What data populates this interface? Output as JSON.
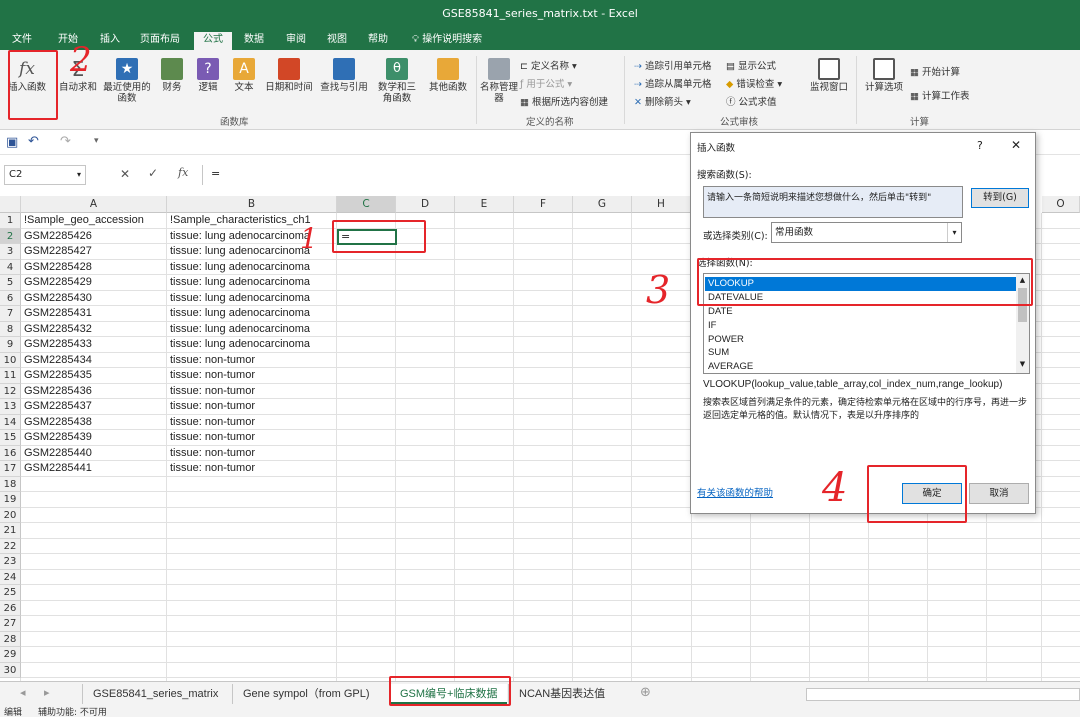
{
  "window": {
    "title": "GSE85841_series_matrix.txt  -  Excel"
  },
  "ribbon_tabs": [
    "文件",
    "开始",
    "插入",
    "页面布局",
    "公式",
    "数据",
    "审阅",
    "视图",
    "帮助"
  ],
  "active_tab": "公式",
  "tell_me": "操作说明搜索",
  "ribbon": {
    "insert_function": "插入函数",
    "autosum": "自动求和",
    "recent": "最近使用的函数",
    "financial": "财务",
    "logical": "逻辑",
    "text": "文本",
    "datetime": "日期和时间",
    "lookup": "查找与引用",
    "math": "数学和三角函数",
    "more": "其他函数",
    "group_library": "函数库",
    "name_manager": "名称管理器",
    "define_name": "定义名称",
    "use_in_formula": "用于公式",
    "create_from_selection": "根据所选内容创建",
    "group_defined_names": "定义的名称",
    "trace_precedents": "追踪引用单元格",
    "trace_dependents": "追踪从属单元格",
    "remove_arrows": "删除箭头",
    "show_formulas": "显示公式",
    "error_checking": "错误检查",
    "evaluate_formula": "公式求值",
    "group_auditing": "公式审核",
    "watch_window": "监视窗口",
    "calc_options": "计算选项",
    "calc_now": "开始计算",
    "calc_sheet": "计算工作表",
    "group_calc": "计算"
  },
  "formula_bar": {
    "name_box": "C2",
    "formula": "="
  },
  "columns": [
    "A",
    "B",
    "C",
    "D",
    "E",
    "F",
    "G",
    "H",
    "O"
  ],
  "rows": [
    [
      "!Sample_geo_accession",
      "!Sample_characteristics_ch1"
    ],
    [
      "GSM2285426",
      "tissue: lung adenocarcinoma"
    ],
    [
      "GSM2285427",
      "tissue: lung adenocarcinoma"
    ],
    [
      "GSM2285428",
      "tissue: lung adenocarcinoma"
    ],
    [
      "GSM2285429",
      "tissue: lung adenocarcinoma"
    ],
    [
      "GSM2285430",
      "tissue: lung adenocarcinoma"
    ],
    [
      "GSM2285431",
      "tissue: lung adenocarcinoma"
    ],
    [
      "GSM2285432",
      "tissue: lung adenocarcinoma"
    ],
    [
      "GSM2285433",
      "tissue: lung adenocarcinoma"
    ],
    [
      "GSM2285434",
      "tissue: non-tumor"
    ],
    [
      "GSM2285435",
      "tissue: non-tumor"
    ],
    [
      "GSM2285436",
      "tissue: non-tumor"
    ],
    [
      "GSM2285437",
      "tissue: non-tumor"
    ],
    [
      "GSM2285438",
      "tissue: non-tumor"
    ],
    [
      "GSM2285439",
      "tissue: non-tumor"
    ],
    [
      "GSM2285440",
      "tissue: non-tumor"
    ],
    [
      "GSM2285441",
      "tissue: non-tumor"
    ]
  ],
  "row_count": 30,
  "active_cell_value": "=",
  "sheets": [
    "GSE85841_series_matrix",
    "Gene sympol（from GPL)",
    "GSM编号+临床数据",
    "NCAN基因表达值"
  ],
  "active_sheet": "GSM编号+临床数据",
  "status": {
    "mode": "编辑",
    "accessibility": "辅助功能: 不可用"
  },
  "dialog": {
    "title": "插入函数",
    "help_char": "?",
    "close_char": "✕",
    "search_label": "搜索函数(S):",
    "search_placeholder": "请输入一条简短说明来描述您想做什么，然后单击\"转到\"",
    "go_button": "转到(G)",
    "category_label": "或选择类别(C):",
    "category_value": "常用函数",
    "list_label": "选择函数(N):",
    "functions": [
      "VLOOKUP",
      "DATEVALUE",
      "DATE",
      "IF",
      "POWER",
      "SUM",
      "AVERAGE"
    ],
    "selected_function": "VLOOKUP",
    "syntax": "VLOOKUP(lookup_value,table_array,col_index_num,range_lookup)",
    "description": "搜索表区域首列满足条件的元素，确定待检索单元格在区域中的行序号，再进一步返回选定单元格的值。默认情况下，表是以升序排序的",
    "help_link": "有关该函数的帮助",
    "ok_button": "确定",
    "cancel_button": "取消"
  },
  "annotations": [
    "1",
    "2",
    "3",
    "4"
  ]
}
